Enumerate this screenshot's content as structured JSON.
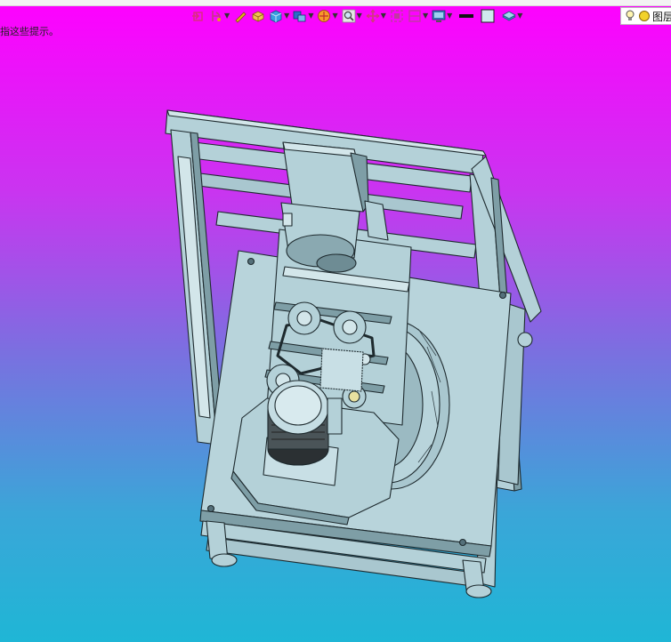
{
  "hint_text": "指这些提示。",
  "toolbar": {
    "buttons": [
      {
        "name": "select-arrow-icon",
        "color": "#d8307a"
      },
      {
        "name": "orient-view-icon",
        "color": "#c43a82"
      },
      {
        "name": "sketch-pencil-icon",
        "color": "#e8b020"
      },
      {
        "name": "part-body-icon",
        "color": "#e8a23a"
      },
      {
        "name": "view-cube-icon",
        "color": "#2a8fd8"
      },
      {
        "name": "display-style-icon",
        "color": "#2a6fc8"
      },
      {
        "name": "section-view-icon",
        "color": "#f07a1a"
      },
      {
        "name": "zoom-icon",
        "color": "#8a8a8a"
      },
      {
        "name": "pan-icon",
        "color": "#d03a7a"
      },
      {
        "name": "zoom-fit-icon",
        "color": "#c03aa0"
      },
      {
        "name": "split-view-icon",
        "color": "#c03aa0"
      },
      {
        "name": "display-monitor-icon",
        "color": "#3a7ab8"
      }
    ],
    "color_swatch_dark": "#111111",
    "color_swatch_light": "#cfe9ee",
    "layers_icon_color": "#3aa0c8"
  },
  "layer_box": {
    "label": "图层"
  },
  "colors": {
    "model_fill": "#b4d1d8",
    "model_light": "#d3e6ea",
    "model_dark": "#7e9ea6",
    "edge": "#1e2a2e"
  }
}
